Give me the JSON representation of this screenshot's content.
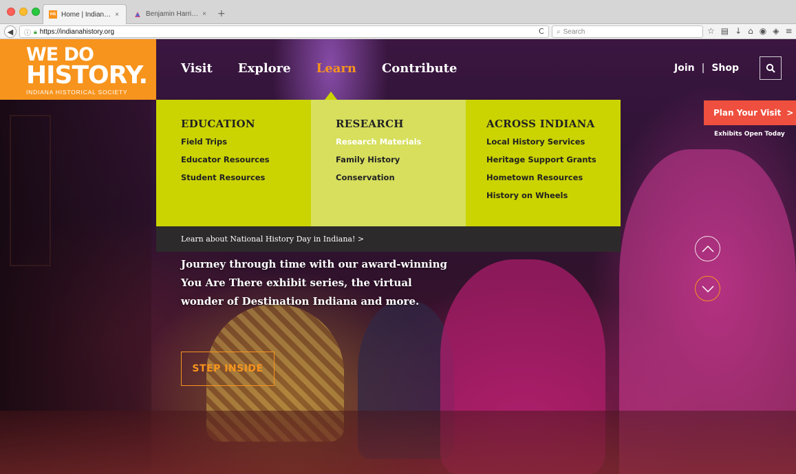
{
  "browser": {
    "tabs": [
      {
        "favicon": "ihs-favicon",
        "title": "Home | Indiana Historical S...",
        "close": "×"
      },
      {
        "favicon": "bh-favicon",
        "title": "Benjamin Harrison collectio...",
        "close": "×"
      }
    ],
    "new_tab": "+",
    "url": "https://indianahistory.org",
    "search_placeholder": "Search",
    "reload": "C"
  },
  "logo": {
    "line1": "WE DO",
    "line2": "HISTORY.",
    "subtitle": "INDIANA HISTORICAL SOCIETY"
  },
  "nav": {
    "items": [
      "Visit",
      "Explore",
      "Learn",
      "Contribute"
    ],
    "active": "Learn",
    "join": "Join",
    "separator": "|",
    "shop": "Shop"
  },
  "mega_menu": {
    "columns": [
      {
        "heading": "EDUCATION",
        "links": [
          "Field Trips",
          "Educator Resources",
          "Student Resources"
        ]
      },
      {
        "heading": "RESEARCH",
        "links": [
          "Research Materials",
          "Family History",
          "Conservation"
        ],
        "highlighted": "Research Materials"
      },
      {
        "heading": "ACROSS INDIANA",
        "links": [
          "Local History Services",
          "Heritage Support Grants",
          "Hometown Resources",
          "History on Wheels"
        ]
      }
    ],
    "footer": "Learn about National History Day in Indiana!  >"
  },
  "sidebar": {
    "plan_visit": "Plan Your Visit",
    "plan_visit_arrow": ">",
    "exhibits_open": "Exhibits Open Today"
  },
  "hero": {
    "text": "Journey through time with our award-winning You Are There exhibit series, the virtual wonder of Destination Indiana and more.",
    "cta": "STEP INSIDE"
  },
  "colors": {
    "brand_orange": "#f7941d",
    "menu_green": "#cbd400",
    "menu_green_light": "#d7df5d",
    "plan_red": "#ef4f3e",
    "menu_footer": "#2d2a2b"
  }
}
